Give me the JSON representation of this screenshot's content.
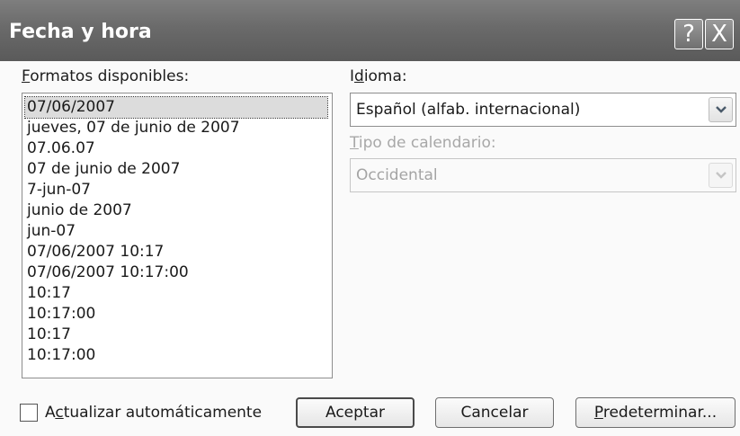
{
  "dialog": {
    "title": "Fecha y hora",
    "help_button": "?",
    "close_button": "X"
  },
  "formats": {
    "label_prefix": "",
    "label_accel": "F",
    "label_rest": "ormatos disponibles:",
    "items": [
      "07/06/2007",
      "jueves, 07 de junio de 2007",
      "07.06.07",
      "07 de junio de 2007",
      "7-jun-07",
      "junio de 2007",
      "jun-07",
      "07/06/2007 10:17",
      "07/06/2007 10:17:00",
      "10:17",
      "10:17:00",
      "10:17",
      "10:17:00"
    ],
    "selected_index": 0
  },
  "language": {
    "label_prefix": "I",
    "label_accel": "d",
    "label_rest": "ioma:",
    "value": "Español (alfab. internacional)"
  },
  "calendar": {
    "label_prefix": "",
    "label_accel": "T",
    "label_rest": "ipo de calendario:",
    "value": "Occidental",
    "disabled": true
  },
  "auto_update": {
    "label_prefix": "A",
    "label_accel": "c",
    "label_rest": "tualizar automáticamente",
    "checked": false
  },
  "buttons": {
    "ok": "Aceptar",
    "cancel": "Cancelar",
    "default_prefix": "",
    "default_accel": "P",
    "default_rest": "redeterminar..."
  },
  "colors": {
    "titlebar": "#6a6a6a",
    "selection": "#dcdcdc",
    "disabled_text": "#a8a8a8"
  }
}
